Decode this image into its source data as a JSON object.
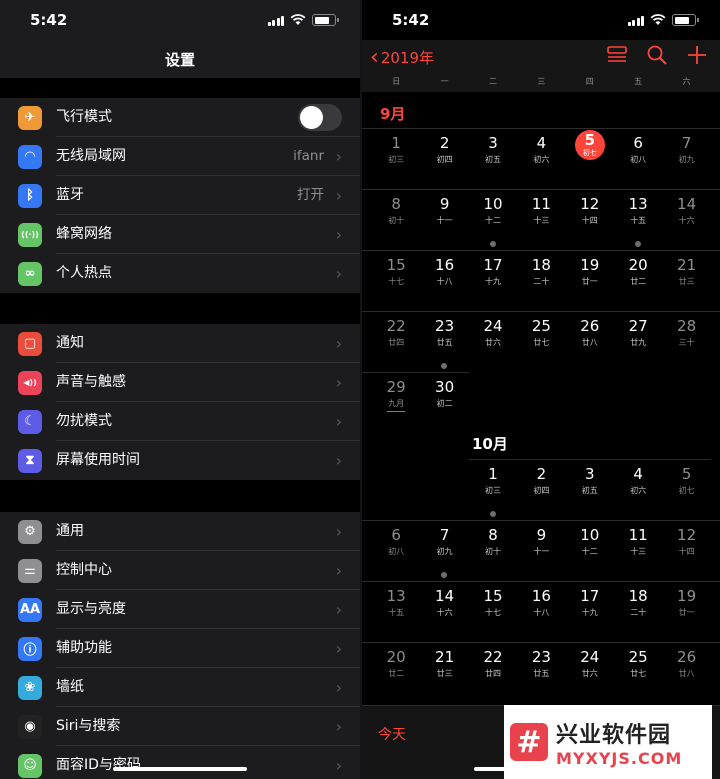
{
  "left": {
    "status_time": "5:42",
    "title": "设置",
    "groups": [
      [
        {
          "label": "飞行模式",
          "icon": "airplane-icon",
          "color": "#f09a37",
          "glyph": "✈",
          "toggle": true
        },
        {
          "label": "无线局域网",
          "icon": "wifi-icon",
          "color": "#3478f6",
          "glyph": "◠",
          "value": "ifanr"
        },
        {
          "label": "蓝牙",
          "icon": "bluetooth-icon",
          "color": "#3478f6",
          "glyph": "ᛒ",
          "value": "打开"
        },
        {
          "label": "蜂窝网络",
          "icon": "cellular-icon",
          "color": "#65c466",
          "glyph": "((·))"
        },
        {
          "label": "个人热点",
          "icon": "hotspot-icon",
          "color": "#65c466",
          "glyph": "∞"
        }
      ],
      [
        {
          "label": "通知",
          "icon": "notifications-icon",
          "color": "#eb4d3d",
          "glyph": "▢"
        },
        {
          "label": "声音与触感",
          "icon": "sound-icon",
          "color": "#eb445a",
          "glyph": "◀))"
        },
        {
          "label": "勿扰模式",
          "icon": "moon-icon",
          "color": "#5e5ce6",
          "glyph": "☾"
        },
        {
          "label": "屏幕使用时间",
          "icon": "hourglass-icon",
          "color": "#5e5ce6",
          "glyph": "⧗"
        }
      ],
      [
        {
          "label": "通用",
          "icon": "gear-icon",
          "color": "#8e8e93",
          "glyph": "⚙"
        },
        {
          "label": "控制中心",
          "icon": "control-center-icon",
          "color": "#8e8e93",
          "glyph": "⚌"
        },
        {
          "label": "显示与亮度",
          "icon": "display-icon",
          "color": "#3478f6",
          "glyph": "AA"
        },
        {
          "label": "辅助功能",
          "icon": "accessibility-icon",
          "color": "#3478f6",
          "glyph": "ⓘ"
        },
        {
          "label": "墙纸",
          "icon": "wallpaper-icon",
          "color": "#35aadc",
          "glyph": "❀"
        },
        {
          "label": "Siri与搜索",
          "icon": "siri-icon",
          "color": "#222",
          "glyph": "◉"
        },
        {
          "label": "面容ID与密码",
          "icon": "faceid-icon",
          "color": "#65c466",
          "glyph": "☺"
        }
      ]
    ]
  },
  "right": {
    "status_time": "5:42",
    "back_label": "2019年",
    "weekdays": [
      "日",
      "一",
      "二",
      "三",
      "四",
      "五",
      "六"
    ],
    "sep_month": "9月",
    "oct_month": "10月",
    "weeks": [
      [
        [
          "1",
          "初三"
        ],
        [
          "2",
          "初四"
        ],
        [
          "3",
          "初五"
        ],
        [
          "4",
          "初六"
        ],
        [
          "5",
          "初七"
        ],
        [
          "6",
          "初八"
        ],
        [
          "7",
          "初九"
        ]
      ],
      [
        [
          "8",
          "初十"
        ],
        [
          "9",
          "十一"
        ],
        [
          "10",
          "十二"
        ],
        [
          "11",
          "十三"
        ],
        [
          "12",
          "十四"
        ],
        [
          "13",
          "十五"
        ],
        [
          "14",
          "十六"
        ]
      ],
      [
        [
          "15",
          "十七"
        ],
        [
          "16",
          "十八"
        ],
        [
          "17",
          "十九"
        ],
        [
          "18",
          "二十"
        ],
        [
          "19",
          "廿一"
        ],
        [
          "20",
          "廿二"
        ],
        [
          "21",
          "廿三"
        ]
      ],
      [
        [
          "22",
          "廿四"
        ],
        [
          "23",
          "廿五"
        ],
        [
          "24",
          "廿六"
        ],
        [
          "25",
          "廿七"
        ],
        [
          "26",
          "廿八"
        ],
        [
          "27",
          "廿九"
        ],
        [
          "28",
          "三十"
        ]
      ],
      [
        [
          "29",
          "九月"
        ],
        [
          "30",
          "初二"
        ]
      ]
    ],
    "oct_weeks": [
      [
        null,
        null,
        [
          "1",
          "初三"
        ],
        [
          "2",
          "初四"
        ],
        [
          "3",
          "初五"
        ],
        [
          "4",
          "初六"
        ],
        [
          "5",
          "初七"
        ]
      ],
      [
        [
          "6",
          "初八"
        ],
        [
          "7",
          "初九"
        ],
        [
          "8",
          "初十"
        ],
        [
          "9",
          "十一"
        ],
        [
          "10",
          "十二"
        ],
        [
          "11",
          "十三"
        ],
        [
          "12",
          "十四"
        ]
      ],
      [
        [
          "13",
          "十五"
        ],
        [
          "14",
          "十六"
        ],
        [
          "15",
          "十七"
        ],
        [
          "16",
          "十八"
        ],
        [
          "17",
          "十九"
        ],
        [
          "18",
          "二十"
        ],
        [
          "19",
          "廿一"
        ]
      ],
      [
        [
          "20",
          "廿二"
        ],
        [
          "21",
          "廿三"
        ],
        [
          "22",
          "廿四"
        ],
        [
          "23",
          "廿五"
        ],
        [
          "24",
          "廿六"
        ],
        [
          "25",
          "廿七"
        ],
        [
          "26",
          "廿八"
        ]
      ]
    ],
    "today_label": "今天",
    "accent": "#ff453a"
  },
  "watermark": {
    "logo_glyph": "#",
    "name": "兴业软件园",
    "url": "MYXYJS.COM"
  }
}
